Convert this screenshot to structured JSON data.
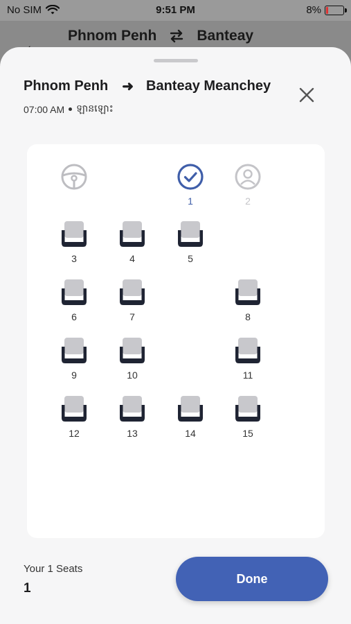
{
  "status_bar": {
    "carrier": "No SIM",
    "time": "9:51 PM",
    "battery": "8%"
  },
  "background_header": {
    "from": "Phnom Penh",
    "to": "Banteay"
  },
  "sheet": {
    "from": "Phnom Penh",
    "to": "Banteay Meanchey",
    "departure_time": "07:00 AM",
    "bus_type": "ឡានឡោះ"
  },
  "seat_map": {
    "driver_icon": "steering-wheel-icon",
    "selected_seat": "1",
    "passenger_seat": "2",
    "seats": [
      "3",
      "4",
      "5",
      "6",
      "7",
      "8",
      "9",
      "10",
      "11",
      "12",
      "13",
      "14",
      "15"
    ]
  },
  "footer": {
    "seats_label": "Your 1 Seats",
    "seats_value": "1",
    "done_label": "Done"
  },
  "colors": {
    "accent": "#4262b5",
    "seat": "#1f2433",
    "seat_cushion": "#c8c8cc"
  }
}
